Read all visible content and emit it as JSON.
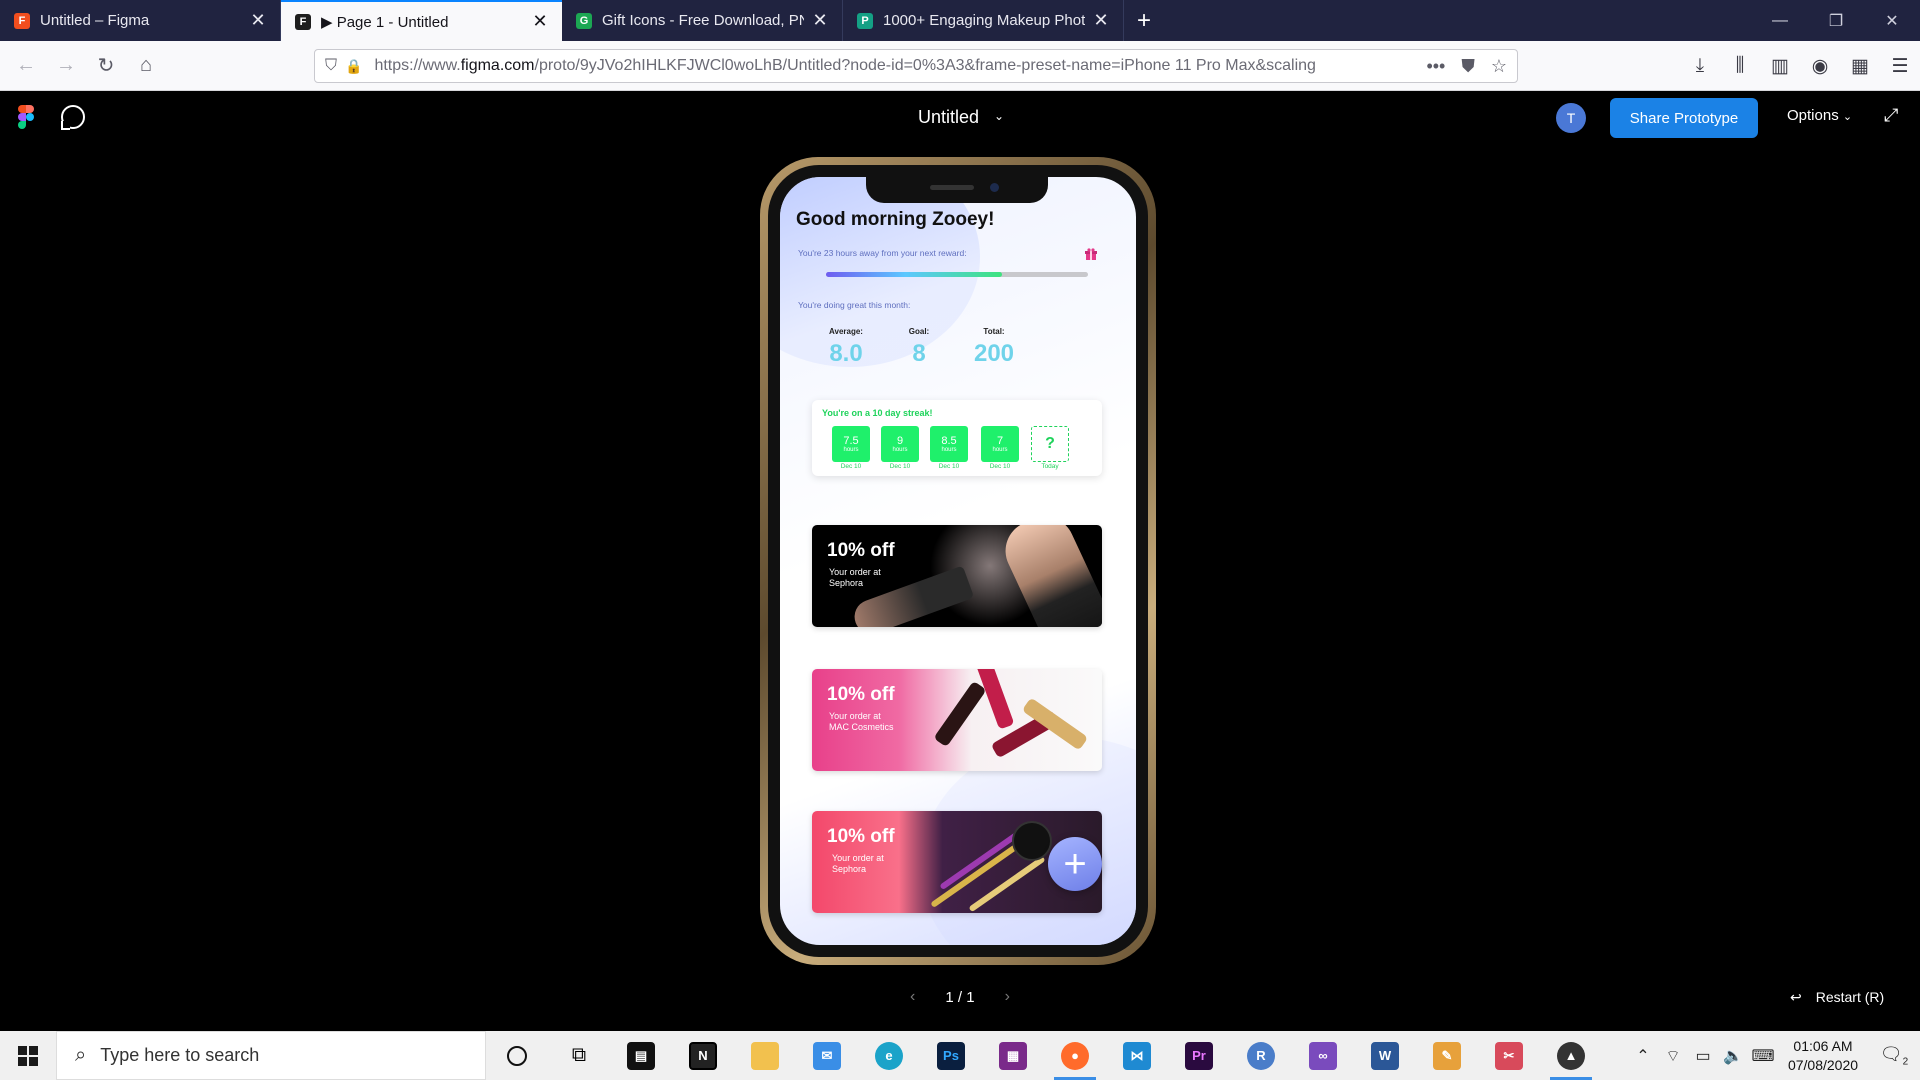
{
  "browser": {
    "tabs": [
      {
        "title": "Untitled – Figma",
        "favicon_color": "#f24e1e",
        "active": false
      },
      {
        "title": "▶ Page 1 - Untitled",
        "favicon_color": "#1e1e1e",
        "active": true
      },
      {
        "title": "Gift Icons - Free Download, PN",
        "favicon_color": "#1ca753",
        "active": false
      },
      {
        "title": "1000+ Engaging Makeup Photo",
        "favicon_color": "#14a085",
        "active": false
      }
    ],
    "url_prefix": "https://www.",
    "url_domain": "figma.com",
    "url_rest": "/proto/9yJVo2hIHLKFJWCl0woLhB/Untitled?node-id=0%3A3&frame-preset-name=iPhone 11 Pro Max&scaling"
  },
  "figma": {
    "file_title": "Untitled",
    "avatar_initial": "T",
    "share_label": "Share Prototype",
    "options_label": "Options",
    "pager": "1 / 1",
    "restart_label": "Restart (R)"
  },
  "app": {
    "greeting": "Good morning Zooey!",
    "reward_text": "You're 23 hours away from  your next reward:",
    "progress_fraction": 0.67,
    "doing_text": "You're doing great this month:",
    "stats": [
      {
        "label": "Average:",
        "value": "8.0"
      },
      {
        "label": "Goal:",
        "value": "8"
      },
      {
        "label": "Total:",
        "value": "200"
      }
    ],
    "streak_title": "You're on a 10 day streak!",
    "streak_days": [
      {
        "value": "7.5",
        "unit": "hours",
        "date": "Dec 10"
      },
      {
        "value": "9",
        "unit": "hours",
        "date": "Dec 10"
      },
      {
        "value": "8.5",
        "unit": "hours",
        "date": "Dec 10"
      },
      {
        "value": "7",
        "unit": "hours",
        "date": "Dec 10"
      },
      {
        "value": "?",
        "unit": "",
        "date": "Today"
      }
    ],
    "coupons": [
      {
        "discount": "10% off",
        "line1": "Your order at",
        "line2": "Sephora"
      },
      {
        "discount": "10% off",
        "line1": "Your order at",
        "line2": "MAC Cosmetics"
      },
      {
        "discount": "10% off",
        "line1": "Your order at",
        "line2": "Sephora"
      }
    ],
    "accent_green": "#1ff06b",
    "stat_color": "#6fd3ea"
  },
  "taskbar": {
    "search_placeholder": "Type here to search",
    "time": "01:06 AM",
    "date": "07/08/2020",
    "notification_count": "2"
  }
}
